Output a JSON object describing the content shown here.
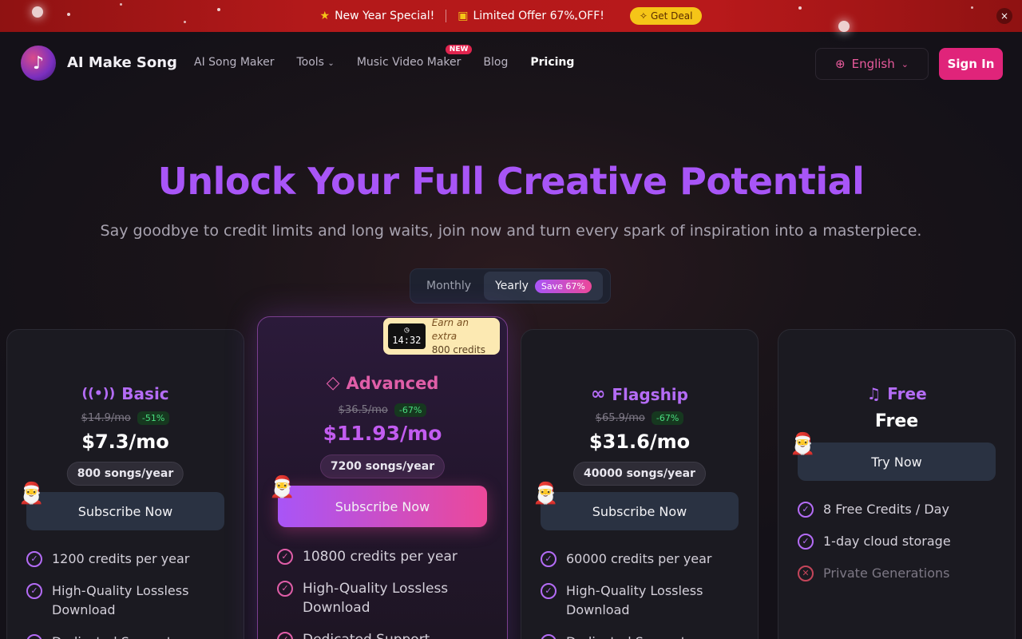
{
  "promo": {
    "new_year": "New Year Special!",
    "offer": "Limited Offer 67% OFF!",
    "deal_label": "Get Deal",
    "close_glyph": "×"
  },
  "nav": {
    "brand": "AI Make Song",
    "links": [
      "AI Song Maker",
      "Tools",
      "Music Video Maker",
      "Blog",
      "Pricing"
    ],
    "new_badge": "NEW",
    "language": "English",
    "sign_in": "Sign In"
  },
  "hero": {
    "title": "Unlock Your Full Creative Potential",
    "subtitle": "Say goodbye to credit limits and long waits, join now and turn every spark of inspiration into a masterpiece."
  },
  "billing": {
    "monthly": "Monthly",
    "yearly": "Yearly",
    "save": "Save 67%",
    "selected": "Yearly"
  },
  "plans": {
    "basic": {
      "name": "Basic",
      "old_price": "$14.9/mo",
      "discount": "-51%",
      "price": "$7.3/mo",
      "songs": "800 songs/year",
      "cta": "Subscribe Now",
      "features": [
        "1200 credits per year",
        "High-Quality Lossless Download",
        "Dedicated Support"
      ]
    },
    "advanced": {
      "name": "Advanced",
      "old_price": "$36.5/mo",
      "discount": "-67%",
      "price": "$11.93/mo",
      "songs": "7200 songs/year",
      "cta": "Subscribe Now",
      "timer": "14:32",
      "timer_line1": "Earn an extra",
      "timer_line2": "800 credits",
      "features": [
        "10800 credits per year",
        "High-Quality Lossless Download",
        "Dedicated Support"
      ]
    },
    "flagship": {
      "name": "Flagship",
      "old_price": "$65.9/mo",
      "discount": "-67%",
      "price": "$31.6/mo",
      "songs": "40000 songs/year",
      "cta": "Subscribe Now",
      "features": [
        "60000 credits per year",
        "High-Quality Lossless Download",
        "Dedicated Support"
      ]
    },
    "free": {
      "name": "Free",
      "price": "Free",
      "cta": "Try Now",
      "features": [
        "8 Free Credits / Day",
        "1-day cloud storage",
        "Private Generations"
      ]
    }
  },
  "colors": {
    "accent_purple": "#a855f7",
    "accent_pink": "#ec4899",
    "promo_red": "#b3191a",
    "deal_yellow": "#f5c518"
  }
}
